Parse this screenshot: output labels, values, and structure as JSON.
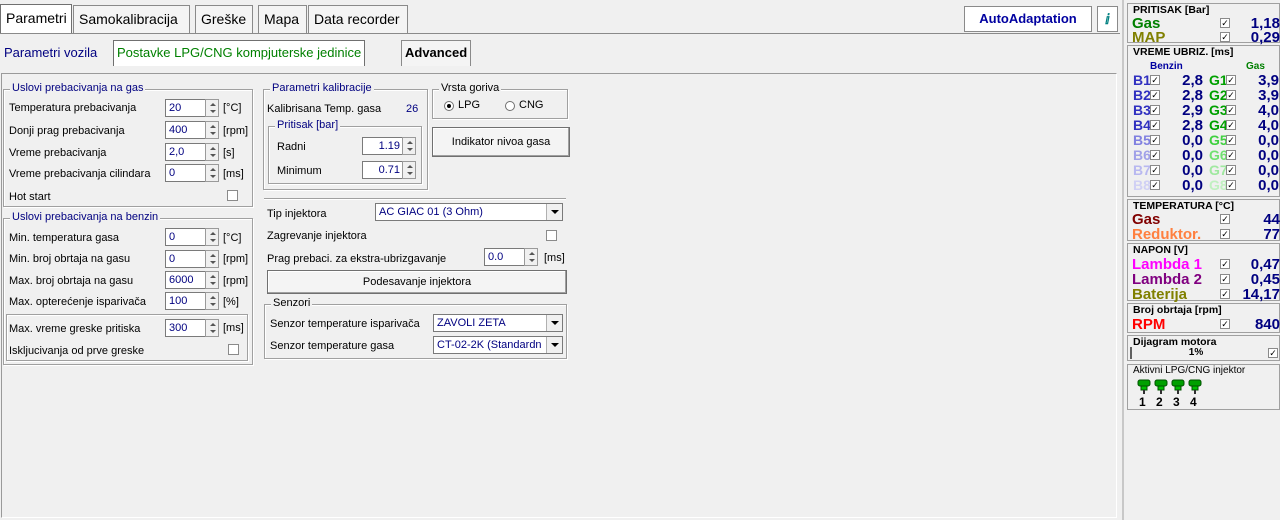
{
  "top_tabs": [
    "Parametri",
    "Samokalibracija",
    "Greške",
    "Mapa",
    "Data recorder"
  ],
  "auto_adaptation_label": "AutoAdaptation",
  "help_icon_glyph": "ⅈ",
  "sub_tabs": [
    "Parametri vozila",
    "Postavke LPG/CNG kompjuterske jedinice",
    "Advanced"
  ],
  "gas_switch": {
    "title": "Uslovi prebacivanja na gas",
    "rows": [
      {
        "label": "Temperatura prebacivanja",
        "value": "20",
        "unit": "[°C]"
      },
      {
        "label": "Donji prag prebacivanja",
        "value": "400",
        "unit": "[rpm]"
      },
      {
        "label": "Vreme prebacivanja",
        "value": "2,0",
        "unit": "[s]"
      },
      {
        "label": "Vreme prebacivanja cilindara",
        "value": "0",
        "unit": "[ms]"
      }
    ],
    "hot_start_label": "Hot start"
  },
  "petrol_switch": {
    "title": "Uslovi prebacivanja na benzin",
    "rows": [
      {
        "label": "Min. temperatura gasa",
        "value": "0",
        "unit": "[°C]"
      },
      {
        "label": "Min. broj obrtaja na gasu",
        "value": "0",
        "unit": "[rpm]"
      },
      {
        "label": "Max. broj obrtaja na gasu",
        "value": "6000",
        "unit": "[rpm]"
      },
      {
        "label": "Max. opterećenje isparivača",
        "value": "100",
        "unit": "[%]"
      }
    ],
    "pressure_error": {
      "label": "Max. vreme greske pritiska",
      "value": "300",
      "unit": "[ms]"
    },
    "first_error_label": "Iskljucivanja od prve greske"
  },
  "calib": {
    "title": "Parametri kalibracije",
    "temp_label": "Kalibrisana Temp. gasa",
    "temp_value": "26",
    "pressure_title": "Pritisak [bar]",
    "radni_label": "Radni",
    "radni_value": "1.19",
    "min_label": "Minimum",
    "min_value": "0.71"
  },
  "fuel_type": {
    "title": "Vrsta goriva",
    "lpg": "LPG",
    "cng": "CNG",
    "selected": "LPG"
  },
  "gas_level_button": "Indikator nivoa gasa",
  "injector": {
    "type_label": "Tip injektora",
    "type_value": "AC GIAC 01 (3 Ohm)",
    "heating_label": "Zagrevanje injektora",
    "extra_label": "Prag prebaci. za ekstra-ubrizgavanje",
    "extra_value": "0.0",
    "extra_unit": "[ms]",
    "setup_button": "Podesavanje injektora"
  },
  "sensors": {
    "title": "Senzori",
    "evap_label": "Senzor temperature isparivača",
    "evap_value": "ZAVOLI ZETA",
    "gas_label": "Senzor temperature gasa",
    "gas_value": "CT-02-2K (Standardn"
  },
  "right": {
    "pressure": {
      "title": "PRITISAK [Bar]",
      "rows": [
        {
          "name": "Gas",
          "value": "1,18",
          "color": "#008000"
        },
        {
          "name": "MAP",
          "value": "0,29",
          "color": "#808000"
        }
      ]
    },
    "inject": {
      "title": "VREME UBRIZ. [ms]",
      "benzin_label": "Benzin",
      "gas_label": "Gas",
      "rows": [
        {
          "b": "B1",
          "bv": "2,8",
          "g": "G1",
          "gv": "3,9",
          "bc": "#3030c0",
          "gc": "#00a000"
        },
        {
          "b": "B2",
          "bv": "2,8",
          "g": "G2",
          "gv": "3,9",
          "bc": "#3030c0",
          "gc": "#00a000"
        },
        {
          "b": "B3",
          "bv": "2,9",
          "g": "G3",
          "gv": "4,0",
          "bc": "#3030c0",
          "gc": "#00a000"
        },
        {
          "b": "B4",
          "bv": "2,8",
          "g": "G4",
          "gv": "4,0",
          "bc": "#3030c0",
          "gc": "#00a000"
        },
        {
          "b": "B5",
          "bv": "0,0",
          "g": "G5",
          "gv": "0,0",
          "bc": "#8080e0",
          "gc": "#40d040"
        },
        {
          "b": "B6",
          "bv": "0,0",
          "g": "G6",
          "gv": "0,0",
          "bc": "#a0a0e8",
          "gc": "#70e070"
        },
        {
          "b": "B7",
          "bv": "0,0",
          "g": "G7",
          "gv": "0,0",
          "bc": "#b8b8f0",
          "gc": "#a0e8a0"
        },
        {
          "b": "B8",
          "bv": "0,0",
          "g": "G8",
          "gv": "0,0",
          "bc": "#d0d0f4",
          "gc": "#c0f0c0"
        }
      ]
    },
    "temperature": {
      "title": "TEMPERATURA [°C]",
      "rows": [
        {
          "name": "Gas",
          "value": "44",
          "color": "#800000"
        },
        {
          "name": "Reduktor.",
          "value": "77",
          "color": "#ff8040"
        }
      ]
    },
    "voltage": {
      "title": "NAPON [V]",
      "rows": [
        {
          "name": "Lambda 1",
          "value": "0,47",
          "color": "#ff00ff"
        },
        {
          "name": "Lambda 2",
          "value": "0,45",
          "color": "#800080"
        },
        {
          "name": "Baterija",
          "value": "14,17",
          "color": "#808000"
        }
      ]
    },
    "rpm": {
      "title": "Broj obrtaja [rpm]",
      "name": "RPM",
      "value": "840",
      "color": "#ff0000"
    },
    "engine": {
      "title": "Dijagram motora",
      "value": "1%"
    },
    "active_inj": {
      "title": "Aktivni LPG/CNG injektor",
      "labels": [
        "1",
        "2",
        "3",
        "4"
      ]
    },
    "check_glyph": "✓"
  }
}
